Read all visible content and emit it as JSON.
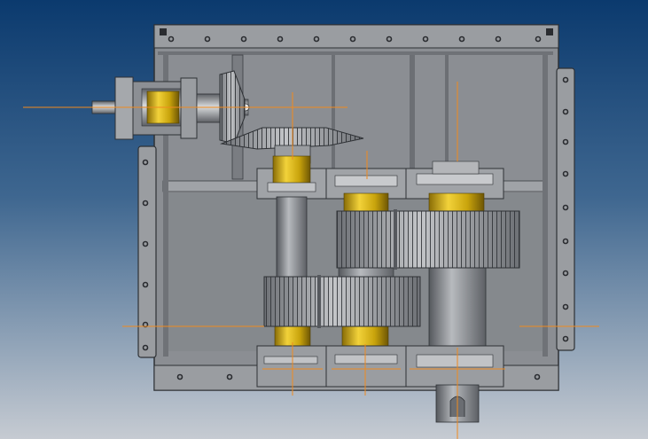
{
  "viewport": {
    "background_top": "#0b3a6e",
    "background_bottom": "#c7ccd3",
    "housing_color": "#8a8d92",
    "housing_edge": "#2e3135",
    "bearing_color": "#c9a40c",
    "bearing_highlight": "#f2d23a",
    "gear_color": "#9ea1a5",
    "centerline_color": "#f08a1e",
    "bolt_color": "#2a2c30"
  },
  "model": {
    "parts": [
      {
        "id": "gearbox-housing"
      },
      {
        "id": "input-shaft"
      },
      {
        "id": "bevel-pinion"
      },
      {
        "id": "bevel-gear"
      },
      {
        "id": "intermediate-shaft-1"
      },
      {
        "id": "intermediate-shaft-2"
      },
      {
        "id": "output-shaft"
      },
      {
        "id": "spur-gear-upper"
      },
      {
        "id": "spur-gear-lower"
      }
    ]
  }
}
